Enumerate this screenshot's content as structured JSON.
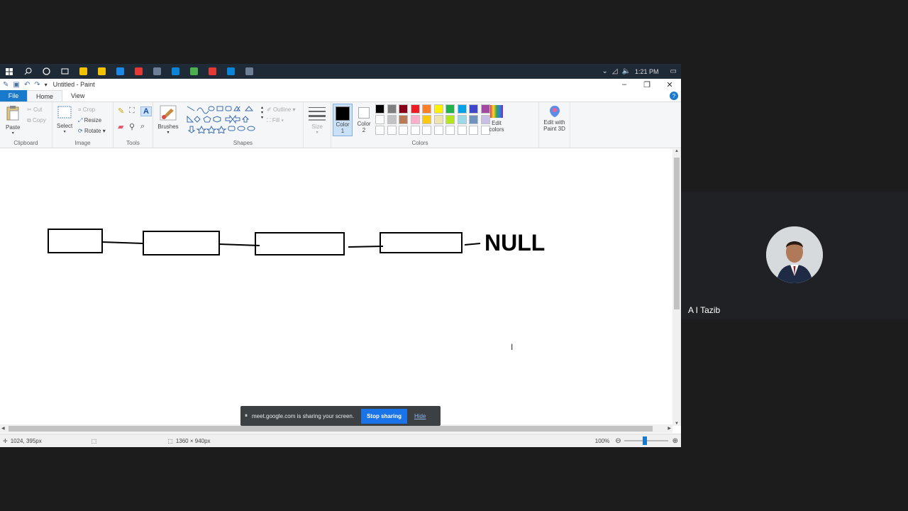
{
  "taskbar": {
    "time": "1:21 PM",
    "apps": [
      "#f3c200",
      "#f3c200",
      "#1e88e5",
      "#e53935",
      "#6d7f94",
      "#0a84d6",
      "#4caf50",
      "#e53935",
      "#0a84d6",
      "#6d7f94"
    ]
  },
  "window": {
    "title": "Untitled - Paint"
  },
  "tabs": {
    "file": "File",
    "home": "Home",
    "view": "View"
  },
  "ribbon": {
    "clipboard": {
      "paste": "Paste",
      "cut": "Cut",
      "copy": "Copy",
      "label": "Clipboard"
    },
    "image": {
      "select": "Select",
      "crop": "Crop",
      "resize": "Resize",
      "rotate": "Rotate",
      "label": "Image"
    },
    "tools": {
      "label": "Tools"
    },
    "brushes": {
      "label": "Brushes"
    },
    "shapes": {
      "outline": "Outline",
      "fill": "Fill",
      "label": "Shapes"
    },
    "size": {
      "label": "Size"
    },
    "colors": {
      "color1_line1": "Color",
      "color1_line2": "1",
      "color2_line1": "Color",
      "color2_line2": "2",
      "edit_colors_line1": "Edit",
      "edit_colors_line2": "colors",
      "paint3d_line1": "Edit with",
      "paint3d_line2": "Paint 3D",
      "label": "Colors",
      "palette_row1": [
        "#000000",
        "#7f7f7f",
        "#880015",
        "#ed1c24",
        "#ff7f27",
        "#fff200",
        "#22b14c",
        "#00a2e8",
        "#3f48cc",
        "#a349a4"
      ],
      "palette_row2": [
        "#ffffff",
        "#c3c3c3",
        "#b97a57",
        "#ffaec9",
        "#ffc90e",
        "#efe4b0",
        "#b5e61d",
        "#99d9ea",
        "#7092be",
        "#c8bfe7"
      ],
      "palette_row3": [
        "#ffffff",
        "#ffffff",
        "#ffffff",
        "#ffffff",
        "#ffffff",
        "#ffffff",
        "#ffffff",
        "#ffffff",
        "#ffffff",
        "#ffffff"
      ]
    }
  },
  "canvas": {
    "null_label": "NULL"
  },
  "statusbar": {
    "cursor_pos": "1024, 395px",
    "canvas_size": "1360 × 940px",
    "zoom": "100%"
  },
  "banner": {
    "message": "meet.google.com is sharing your screen.",
    "stop": "Stop sharing",
    "hide": "Hide"
  },
  "participant": {
    "name": "A I Tazib"
  }
}
